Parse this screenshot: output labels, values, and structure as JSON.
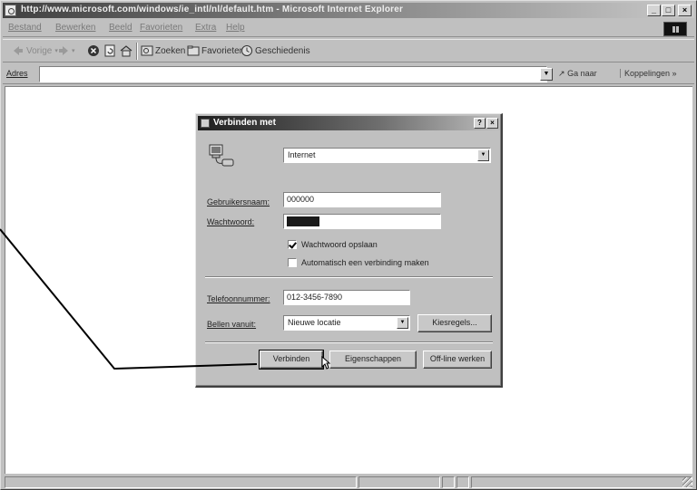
{
  "window": {
    "title": "http://www.microsoft.com/windows/ie_intl/nl/default.htm - Microsoft Internet Explorer",
    "minimize_label": "_",
    "maximize_label": "□",
    "close_label": "×"
  },
  "menubar": {
    "items": [
      "Bestand",
      "Bewerken",
      "Beeld",
      "Favorieten",
      "Extra",
      "Help"
    ]
  },
  "toolbar": {
    "back_label": "Vorige",
    "search_label": "Zoeken",
    "favorites_label": "Favorieten",
    "history_label": "Geschiedenis"
  },
  "addressbar": {
    "label": "Adres",
    "value": "",
    "go_label": "Ga naar",
    "links_label": "Koppelingen »"
  },
  "dialog": {
    "title": "Verbinden met",
    "help_label": "?",
    "close_label": "×",
    "connection_value": "Internet",
    "username_label": "Gebruikersnaam:",
    "username_value": "000000",
    "password_label": "Wachtwoord:",
    "save_password_label": "Wachtwoord opslaan",
    "save_password_checked": true,
    "auto_connect_label": "Automatisch een verbinding maken",
    "auto_connect_checked": false,
    "phone_label": "Telefoonnummer:",
    "phone_value": "012-3456-7890",
    "dialing_from_label": "Bellen vanuit:",
    "dialing_from_value": "Nieuwe locatie",
    "dial_properties_label": "Kiesregels...",
    "connect_label": "Verbinden",
    "properties_label": "Eigenschappen",
    "work_offline_label": "Off-line werken"
  }
}
